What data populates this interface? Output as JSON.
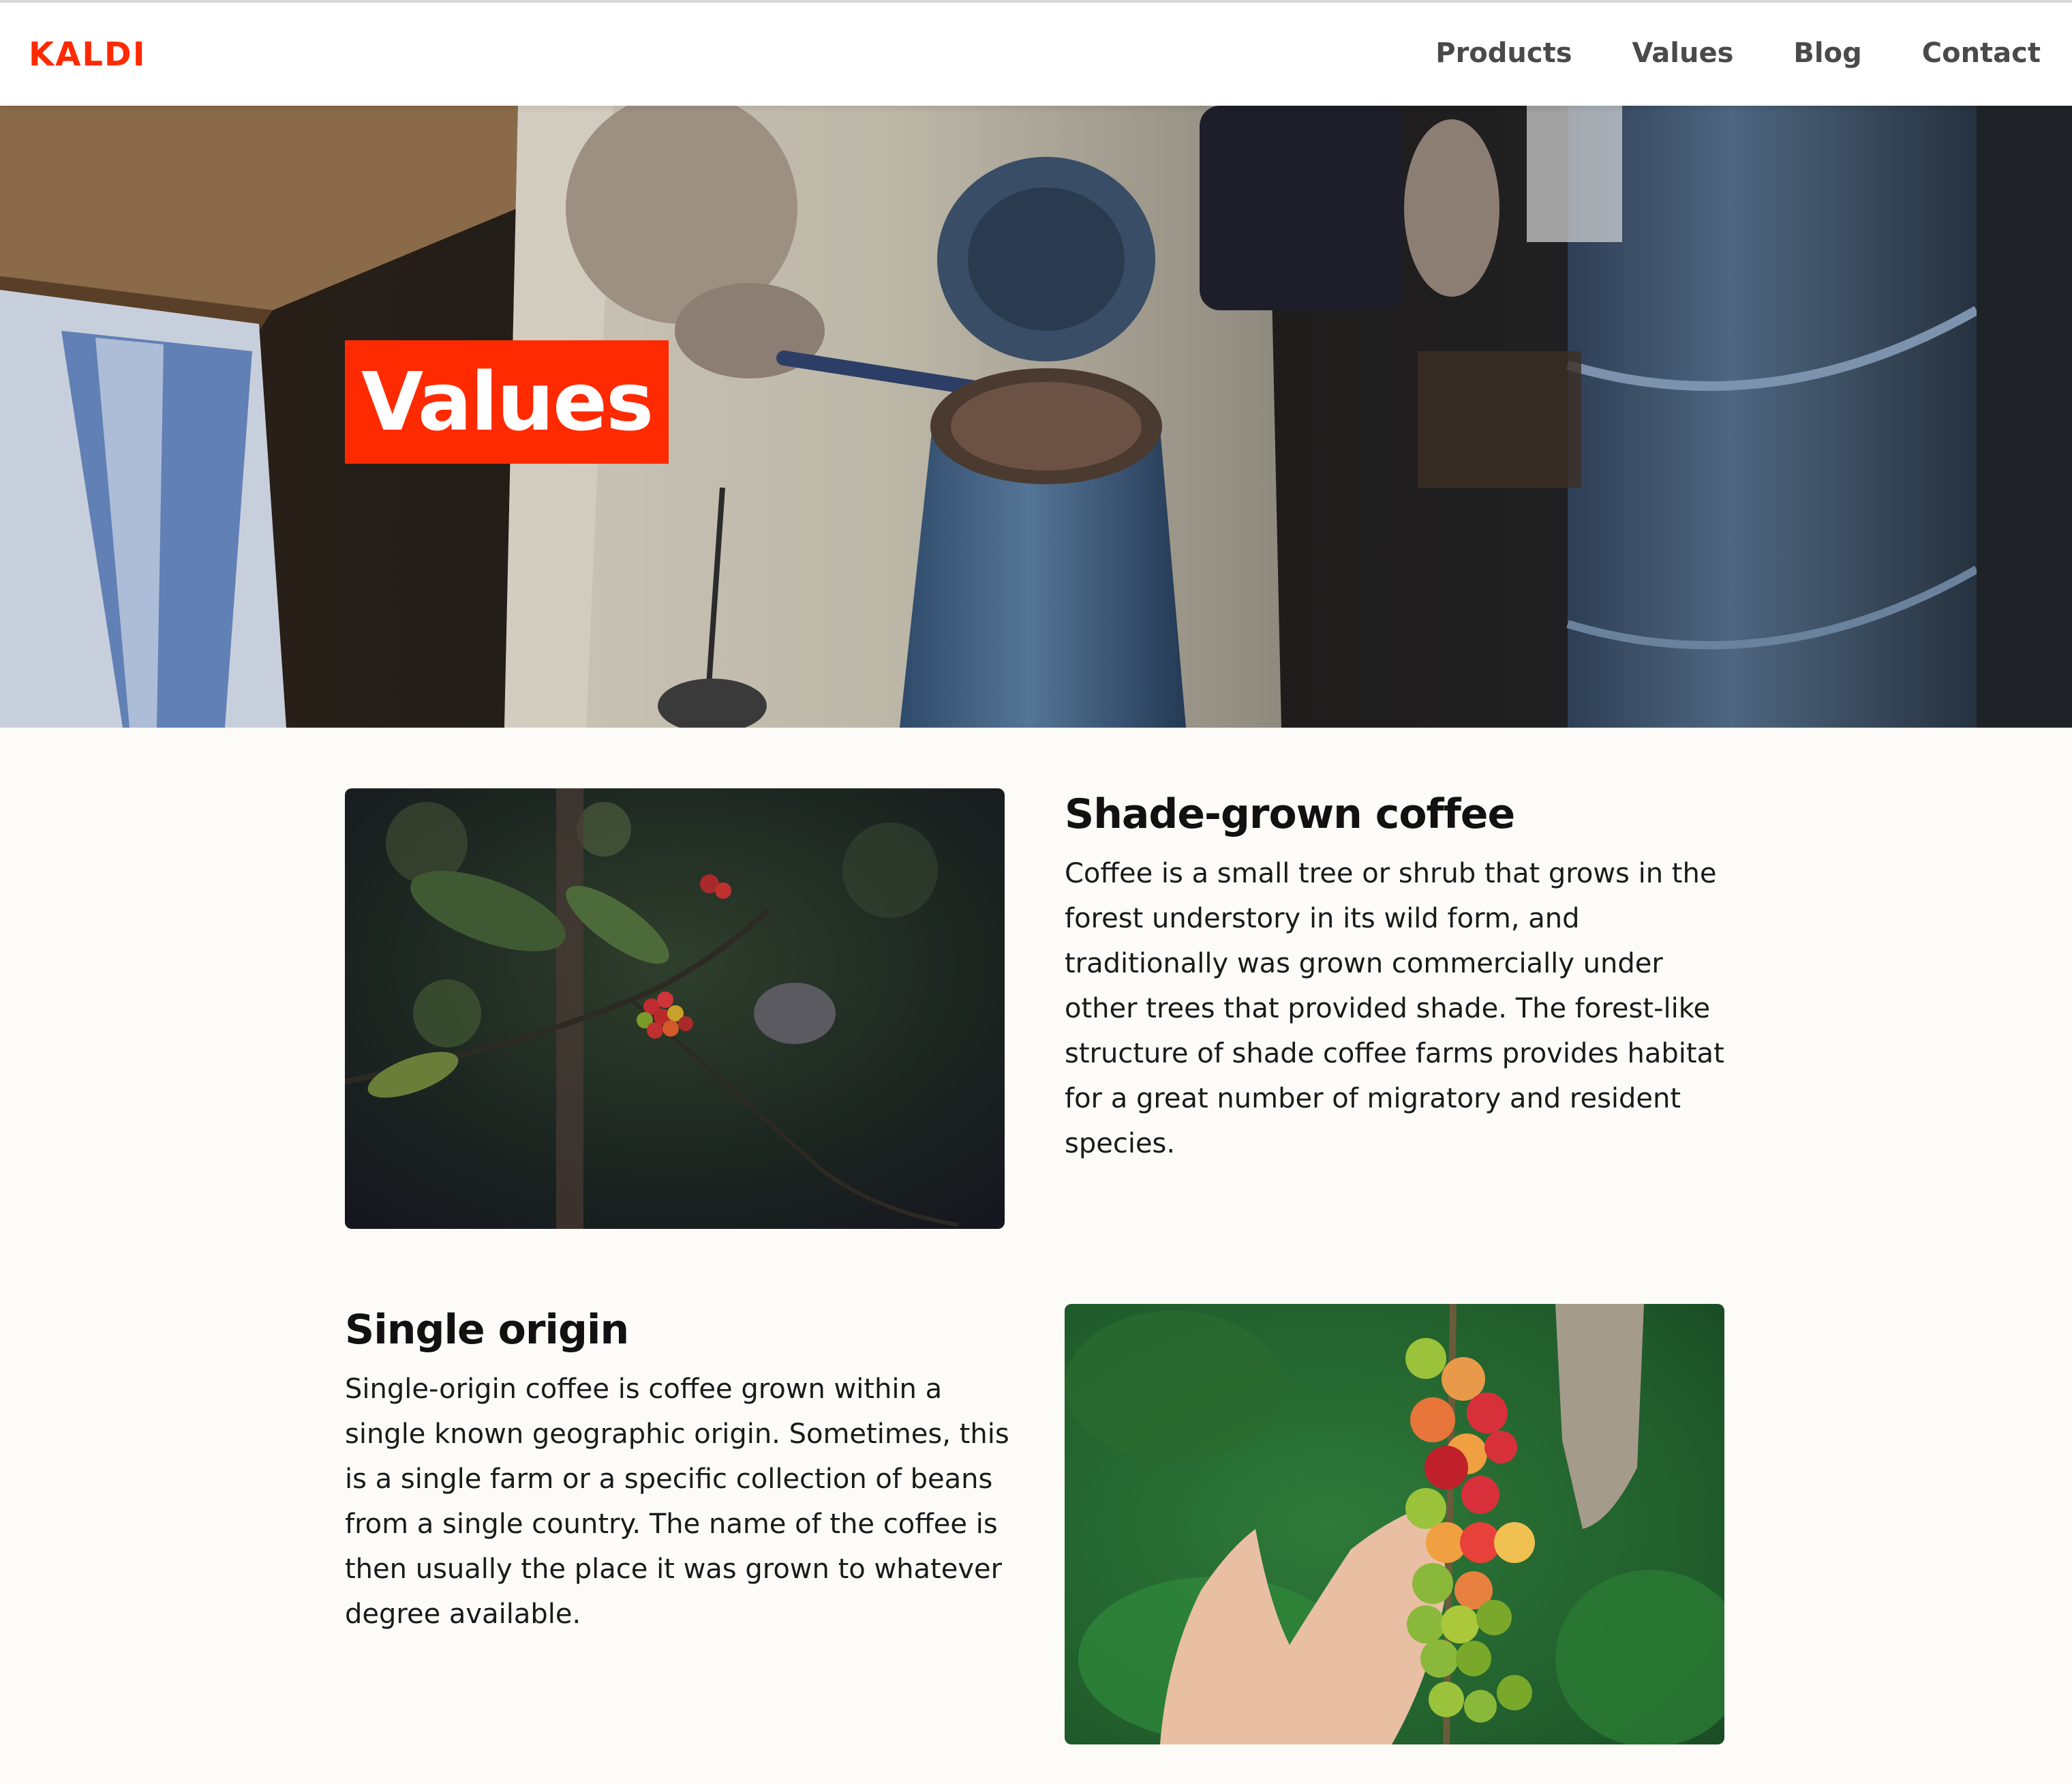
{
  "brand": {
    "name": "KALDI",
    "color": "#ff2a00"
  },
  "nav": {
    "items": [
      {
        "label": "Products"
      },
      {
        "label": "Values"
      },
      {
        "label": "Blog"
      },
      {
        "label": "Contact"
      }
    ]
  },
  "hero": {
    "title": "Values",
    "title_bg": "#ff2a00",
    "image": "coffee-brewing-photo"
  },
  "sections": [
    {
      "heading": "Shade-grown coffee",
      "text": "Coffee is a small tree or shrub that grows in the forest understory in its wild form, and traditionally was grown commercially under other trees that provided shade. The forest-like structure of shade coffee farms provides habitat for a great number of migratory and resident species.",
      "image": "coffee-branch-photo"
    },
    {
      "heading": "Single origin",
      "text": "Single-origin coffee is coffee grown within a single known geographic origin. Sometimes, this is a single farm or a specific collection of beans from a single country. The name of the coffee is then usually the place it was grown to whatever degree available.",
      "image": "coffee-cherries-hand-photo"
    }
  ]
}
